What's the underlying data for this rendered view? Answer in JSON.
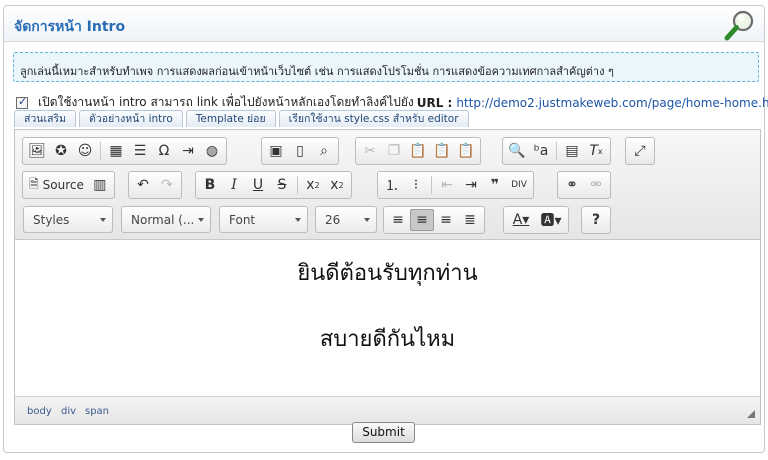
{
  "panel": {
    "title": "จัดการหน้า Intro"
  },
  "info_text": "ลูกเล่นนี้เหมาะสำหรับทำเพจ การแสดงผลก่อนเข้าหน้าเว็บไซต์ เช่น การแสดงโปรโมชั่น การแสดงข้อความเทศกาลสำคัญต่าง ๆ",
  "enable": {
    "checked": true,
    "text": "เปิดใช้งานหน้า intro สามารถ link เพื่อไปยังหน้าหลักเองโดยทำลิงค์ไปยัง",
    "url_label": "URL :",
    "url": "http://demo2.justmakeweb.com/page/home-home.html"
  },
  "tabs": [
    "ส่วนเสริม",
    "ตัวอย่างหน้า intro",
    "Template ย่อย",
    "เรียกใช้งาน style.css สำหรับ editor"
  ],
  "toolbar": {
    "source_label": "Source",
    "styles_label": "Styles",
    "format_label": "Normal (...",
    "font_label": "Font",
    "size_label": "26",
    "icons_row1": [
      "image-icon",
      "flash-icon",
      "smiley-icon",
      "table-icon",
      "horizontal-rule-icon",
      "special-char-icon",
      "page-break-icon",
      "iframe-icon",
      "save-icon",
      "new-page-icon",
      "preview-icon",
      "cut-icon",
      "copy-icon",
      "paste-icon",
      "paste-text-icon",
      "paste-word-icon",
      "find-icon",
      "replace-icon",
      "select-all-icon",
      "remove-format-icon",
      "maximize-icon"
    ],
    "icons_row2": [
      "source-icon",
      "templates-icon",
      "undo-icon",
      "redo-icon",
      "bold-icon",
      "italic-icon",
      "underline-icon",
      "strike-icon",
      "subscript-icon",
      "superscript-icon",
      "numbered-list-icon",
      "bulleted-list-icon",
      "outdent-icon",
      "indent-icon",
      "blockquote-icon",
      "create-div-icon",
      "link-icon",
      "unlink-icon"
    ],
    "icons_row3": [
      "align-left-icon",
      "align-center-icon",
      "align-right-icon",
      "justify-icon",
      "text-color-icon",
      "bg-color-icon",
      "help-icon"
    ]
  },
  "content": {
    "line1": "ยินดีต้อนรับทุกท่าน",
    "line2": "สบายดีกันไหม"
  },
  "statusbar": {
    "path": [
      "body",
      "div",
      "span"
    ]
  },
  "submit_label": "Submit"
}
